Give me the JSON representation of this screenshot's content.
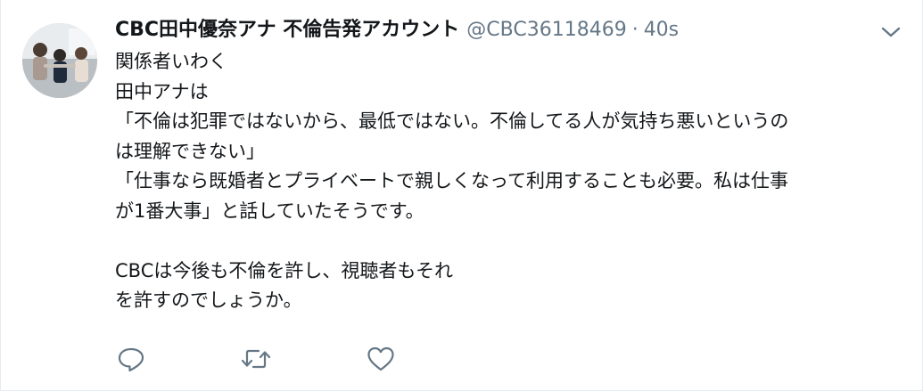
{
  "tweet": {
    "display_name": "CBC田中優奈アナ 不倫告発アカウント",
    "handle": "@CBC36118469",
    "separator": "·",
    "time": "40s",
    "text_lines": [
      "関係者いわく",
      "田中アナは",
      "「不倫は犯罪ではないから、最低ではない。不倫してる人が気持ち悪いというの",
      "は理解できない」",
      "「仕事なら既婚者とプライベートで親しくなって利用することも必要。私は仕事",
      "が1番大事」と話していたそうです。",
      "",
      "CBCは今後も不倫を許し、視聴者もそれ",
      "を許すのでしょうか。"
    ]
  },
  "icons": {
    "more": "chevron-down-icon",
    "reply": "reply-icon",
    "retweet": "retweet-icon",
    "like": "heart-icon"
  },
  "colors": {
    "text": "#14171a",
    "secondary": "#657786",
    "border": "#e6ecf0"
  }
}
